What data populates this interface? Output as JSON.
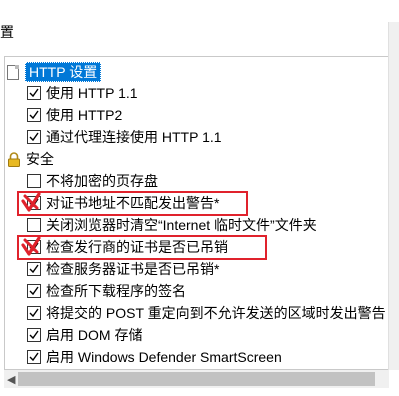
{
  "header": {
    "title": "置"
  },
  "tree": {
    "http_section": {
      "label": "HTTP 设置"
    },
    "http_items": [
      {
        "label": "使用 HTTP 1.1",
        "checked": true
      },
      {
        "label": "使用 HTTP2",
        "checked": true
      },
      {
        "label": "通过代理连接使用 HTTP 1.1",
        "checked": true
      }
    ],
    "security_section": {
      "label": "安全"
    },
    "security_items": [
      {
        "label": "不将加密的页存盘",
        "checked": false
      },
      {
        "label": "对证书地址不匹配发出警告*",
        "checked": true,
        "highlighted": true
      },
      {
        "label": "关闭浏览器时清空“Internet 临时文件”文件夹",
        "checked": false
      },
      {
        "label": "检查发行商的证书是否已吊销",
        "checked": true,
        "highlighted": true
      },
      {
        "label": "检查服务器证书是否已吊销*",
        "checked": true
      },
      {
        "label": "检查所下载程序的签名",
        "checked": true
      },
      {
        "label": "将提交的 POST 重定向到不允许发送的区域时发出警告",
        "checked": true
      },
      {
        "label": "启用 DOM 存储",
        "checked": true
      },
      {
        "label": "启用 Windows Defender SmartScreen",
        "checked": true
      }
    ]
  },
  "icons": {
    "page": "page-icon",
    "lock": "lock-icon",
    "check": "checkmark-icon"
  },
  "colors": {
    "selection": "#0078d7",
    "highlight_box": "#e0222c",
    "red_mark": "#e0222c"
  }
}
